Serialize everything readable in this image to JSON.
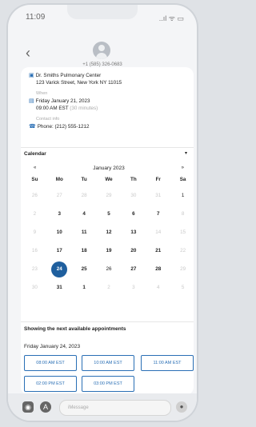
{
  "status": {
    "time": "11:09",
    "icons": "..ıl ᯤ ▭"
  },
  "header": {
    "phone": "+1 (585) 326-0683",
    "back_icon": "chevron-left-icon"
  },
  "provider": {
    "name": "Dr. Smiths Pulmonary Center",
    "address": "123 Varick Street, New York NY 11015",
    "when_label": "When",
    "date_time_1": "Friday January 21, 2023",
    "date_time_2": "09:00 AM EST",
    "duration": "(30 minutes)",
    "contact_label": "Contact info",
    "phone": "Phone: (212) 555-1212"
  },
  "calendar": {
    "title": "Calendar",
    "month": "January 2023",
    "prev": "«",
    "next": "»",
    "dow": [
      "Su",
      "Mo",
      "Tu",
      "We",
      "Th",
      "Fr",
      "Sa"
    ],
    "weeks": [
      [
        "26",
        "27",
        "28",
        "29",
        "30",
        "31",
        "1"
      ],
      [
        "2",
        "3",
        "4",
        "5",
        "6",
        "7",
        "8"
      ],
      [
        "9",
        "10",
        "11",
        "12",
        "13",
        "14",
        "15"
      ],
      [
        "16",
        "17",
        "18",
        "19",
        "20",
        "21",
        "22"
      ],
      [
        "23",
        "24",
        "25",
        "26",
        "27",
        "28",
        "29"
      ],
      [
        "30",
        "31",
        "1",
        "2",
        "3",
        "4",
        "5"
      ]
    ],
    "selected": "24"
  },
  "appointments": {
    "heading": "Showing the next available appointments",
    "date": "Friday January 24, 2023",
    "slots": [
      "08:00 AM EST",
      "10:00 AM EST",
      "11:00 AM EST",
      "02:00 PM EST",
      "03:00 PM EST"
    ]
  },
  "composer": {
    "placeholder": "iMessage"
  }
}
